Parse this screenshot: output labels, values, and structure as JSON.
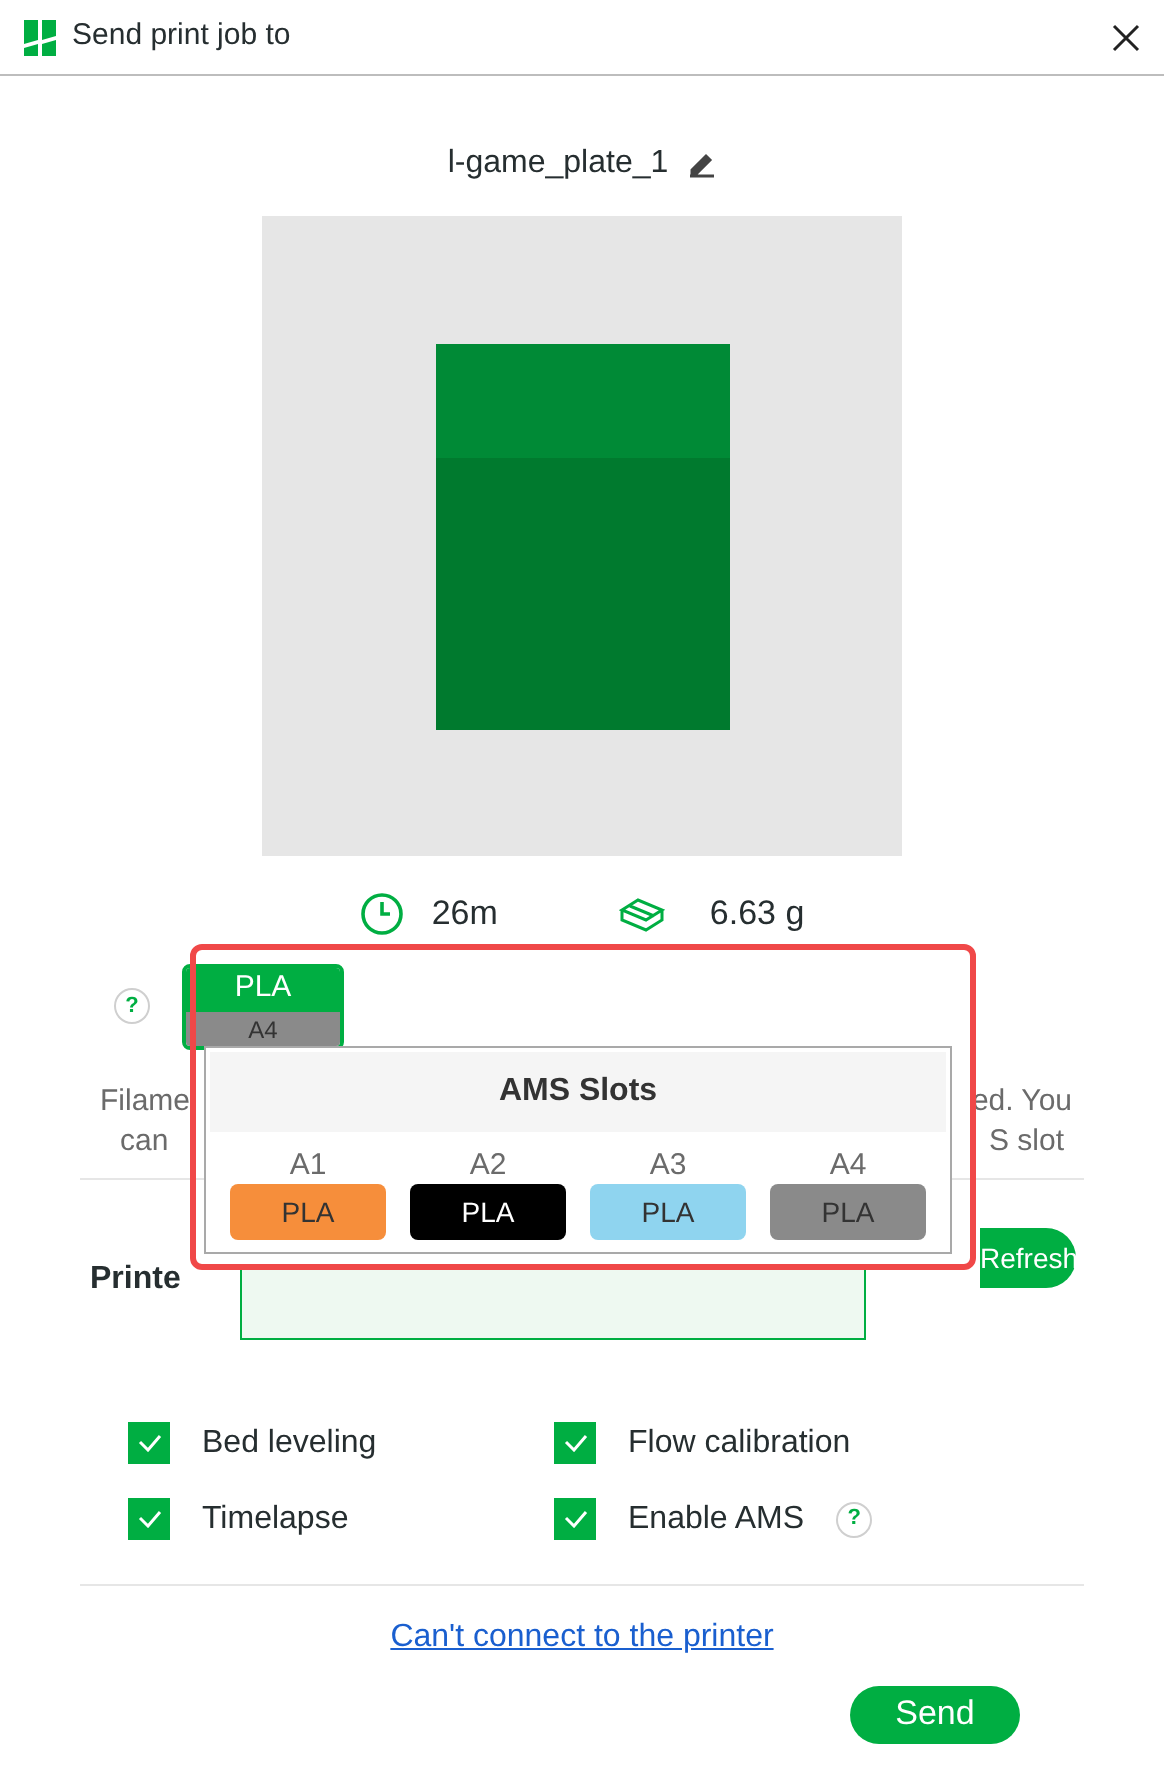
{
  "window": {
    "title": "Send print job to"
  },
  "plate": {
    "name": "l-game_plate_1"
  },
  "stats": {
    "time": "26m",
    "weight": "6.63 g"
  },
  "filament_help": "?",
  "filament_tag": {
    "material": "PLA",
    "slot": "A4",
    "color": "#00ae42"
  },
  "filament_note": {
    "line_1_left": "Filame",
    "line_1_right": "ed. You",
    "line_2_left": "can",
    "line_2_right": "S slot"
  },
  "printer": {
    "label": "Printe",
    "refresh": "Refresh"
  },
  "ams_popup": {
    "title": "AMS Slots",
    "slots": [
      {
        "id": "A1",
        "material": "PLA",
        "color": "#f68e3b"
      },
      {
        "id": "A2",
        "material": "PLA",
        "color": "#000000"
      },
      {
        "id": "A3",
        "material": "PLA",
        "color": "#8fd4ef"
      },
      {
        "id": "A4",
        "material": "PLA",
        "color": "#8a8a8a"
      }
    ]
  },
  "options": [
    {
      "label": "Bed leveling",
      "checked": true
    },
    {
      "label": "Flow calibration",
      "checked": true
    },
    {
      "label": "Timelapse",
      "checked": true
    },
    {
      "label": "Enable AMS",
      "checked": true,
      "help": "?"
    }
  ],
  "link": "Can't connect to the printer",
  "send_button": "Send"
}
